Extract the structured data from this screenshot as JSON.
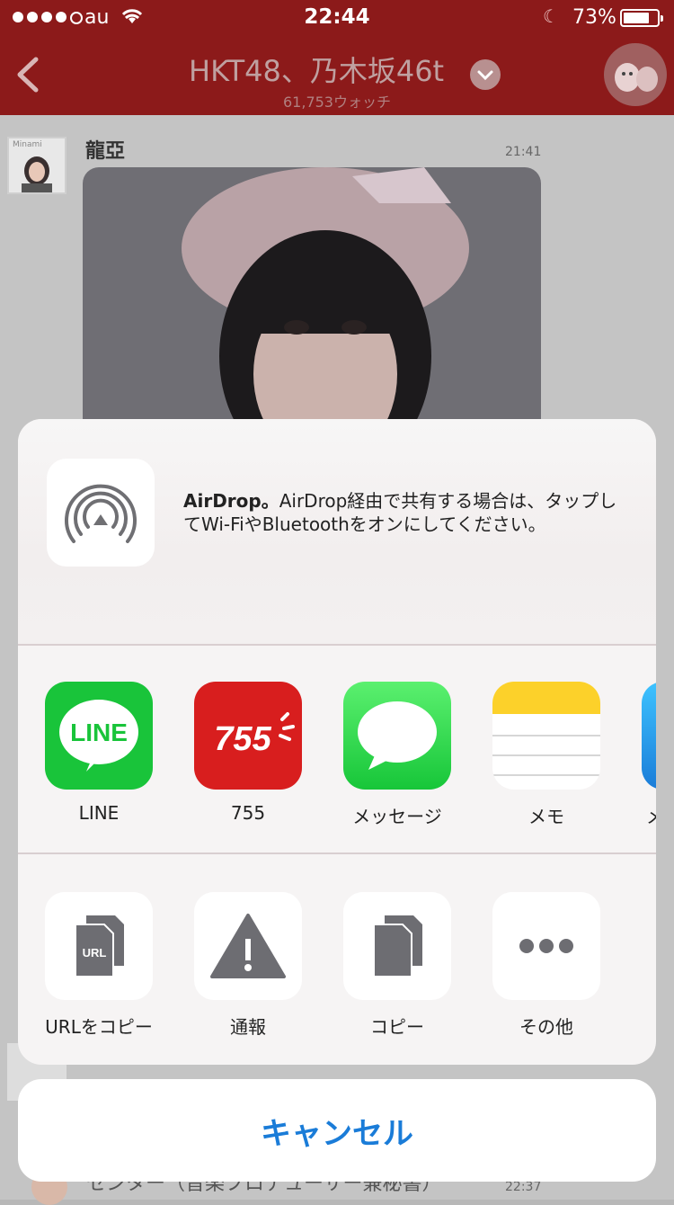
{
  "status": {
    "carrier": "au",
    "time": "22:44",
    "battery_pct": "73%"
  },
  "nav": {
    "title": "HKT48、乃木坂46t",
    "subtitle": "61,753ウォッチ"
  },
  "chat": {
    "sender": "龍亞",
    "time1": "21:41",
    "avatar_caption": "Minami",
    "next_sender": "センター（音楽プロデューサー兼秘書）",
    "time2": "22:37"
  },
  "share": {
    "airdrop_text_bold": "AirDrop。",
    "airdrop_text": "AirDrop経由で共有する場合は、タップしてWi-FiやBluetoothをオンにしてください。",
    "apps": [
      {
        "label": "LINE",
        "icon": "line-icon",
        "icon_text": "LINE"
      },
      {
        "label": "755",
        "icon": "app-755-icon",
        "icon_text": "755"
      },
      {
        "label": "メッセージ",
        "icon": "messages-icon"
      },
      {
        "label": "メモ",
        "icon": "notes-icon"
      },
      {
        "label": "メ",
        "icon": "mail-icon"
      }
    ],
    "actions": [
      {
        "label": "URLをコピー",
        "icon": "copy-url-icon",
        "icon_text": "URL"
      },
      {
        "label": "通報",
        "icon": "report-icon"
      },
      {
        "label": "コピー",
        "icon": "copy-icon"
      },
      {
        "label": "その他",
        "icon": "more-icon"
      }
    ],
    "cancel": "キャンセル"
  },
  "colors": {
    "nav_red": "#8c1a1a",
    "line_green": "#19c43a",
    "app755_red": "#d81e1e",
    "ios_blue": "#1a7cd8"
  }
}
